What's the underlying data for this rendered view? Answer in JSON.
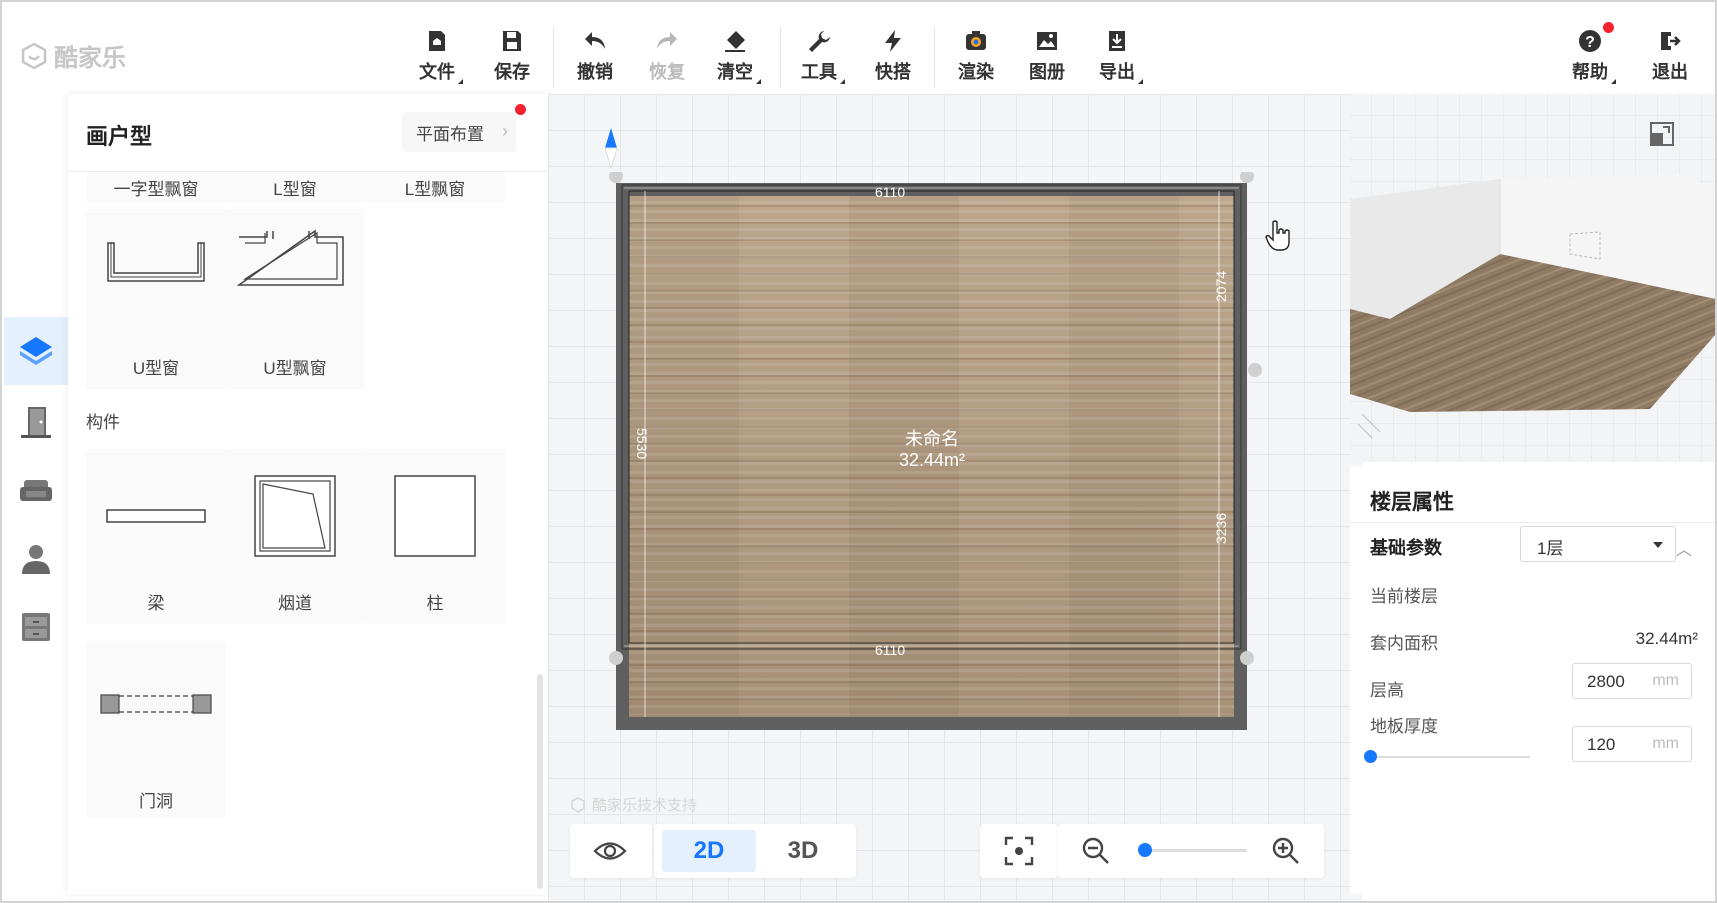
{
  "app": {
    "logo_text": "酷家乐"
  },
  "toolbar": {
    "file": "文件",
    "save": "保存",
    "undo": "撤销",
    "redo": "恢复",
    "clear": "清空",
    "tools": "工具",
    "quick": "快搭",
    "render": "渲染",
    "album": "图册",
    "export": "导出",
    "help": "帮助",
    "exit": "退出"
  },
  "rail": {
    "items": [
      "floorplan-icon",
      "door-icon",
      "sofa-icon",
      "person-icon",
      "cabinet-icon"
    ],
    "active_index": 0
  },
  "panel": {
    "title": "画户型",
    "plan_button": "平面布置",
    "top_row": [
      "一字型飘窗",
      "L型窗",
      "L型飘窗"
    ],
    "windows": [
      "U型窗",
      "U型飘窗"
    ],
    "section_components": "构件",
    "components": [
      "梁",
      "烟道",
      "柱"
    ],
    "components_row2": [
      "门洞"
    ]
  },
  "canvas": {
    "room_name": "未命名",
    "room_area": "32.44m²",
    "dims": {
      "top": "6110",
      "bottom": "6110",
      "left": "5530",
      "right_top": "2074",
      "right_bottom": "3236"
    },
    "watermark": "酷家乐技术支持"
  },
  "view": {
    "mode_2d": "2D",
    "mode_3d": "3D",
    "active": "2D",
    "zoom_fraction": 0.06
  },
  "properties": {
    "title": "楼层属性",
    "section": "基础参数",
    "current_floor_label": "当前楼层",
    "current_floor_value": "1层",
    "area_label": "套内面积",
    "area_value": "32.44m²",
    "height_label": "层高",
    "height_value": "2800",
    "height_unit": "mm",
    "thickness_label": "地板厚度",
    "thickness_value": "120",
    "thickness_unit": "mm",
    "thickness_slider_fraction": 0.0
  },
  "colors": {
    "accent": "#1677ff",
    "wall": "#5f5f5f",
    "floor": "#b39d84",
    "notification": "#f5222d"
  }
}
